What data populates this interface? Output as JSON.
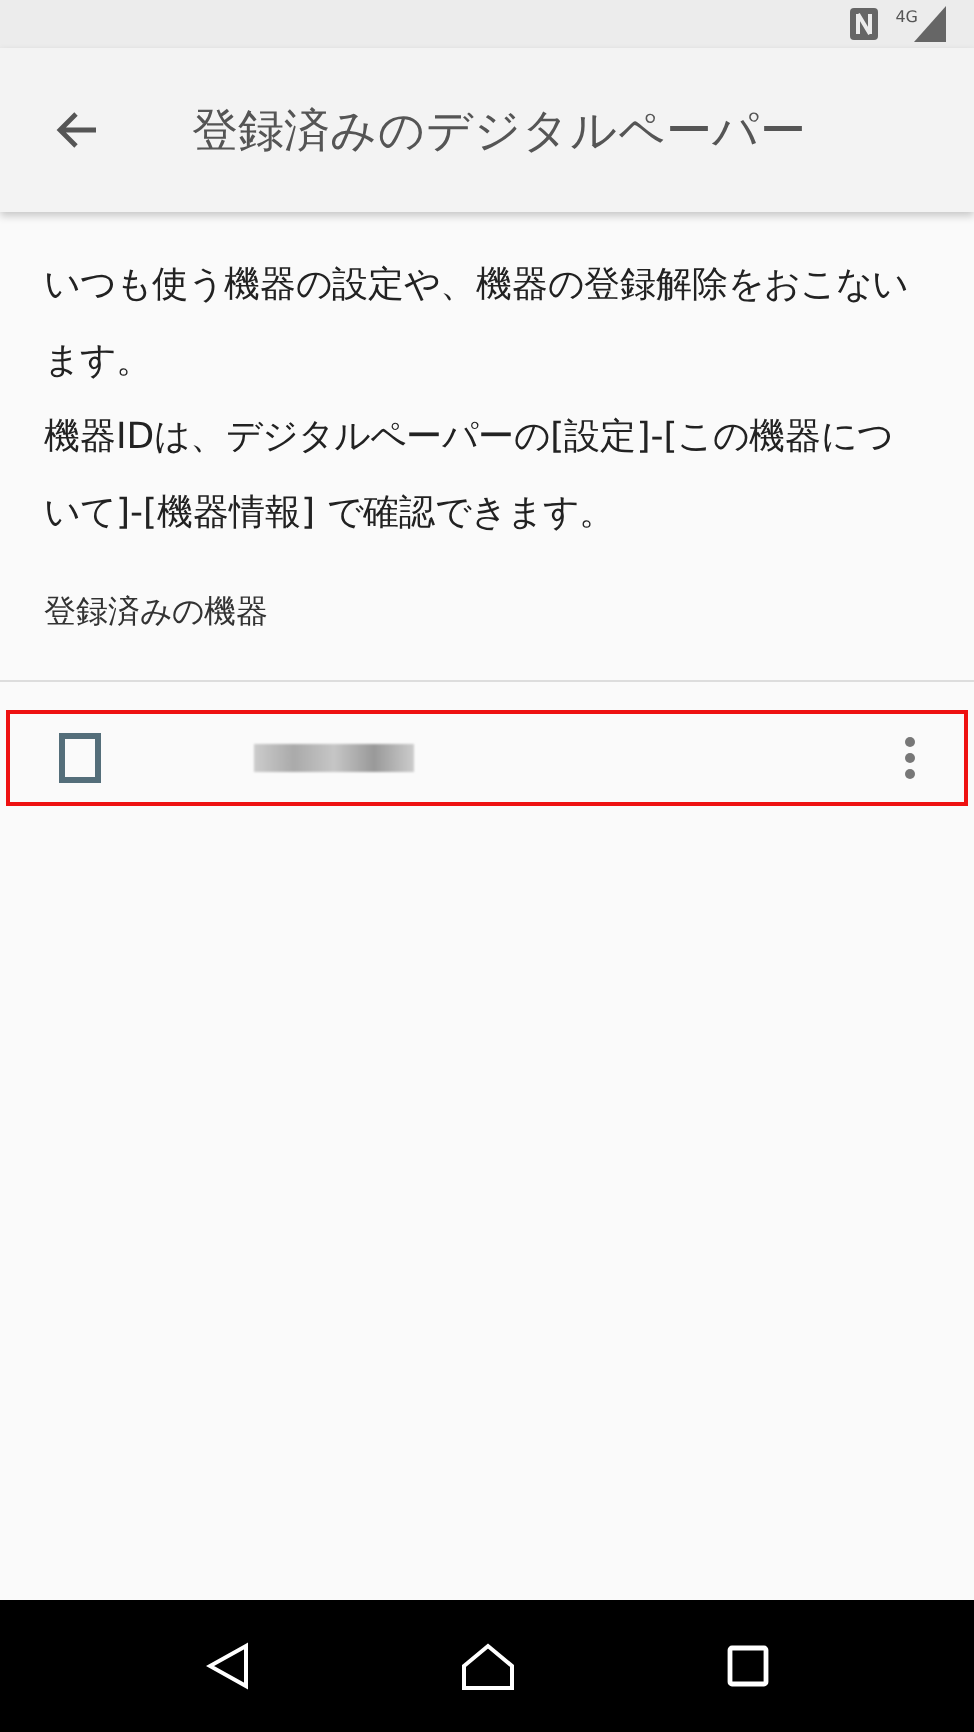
{
  "status_bar": {
    "network": "4G"
  },
  "app_bar": {
    "title": "登録済みのデジタルペーパー"
  },
  "description": [
    "いつも使う機器の設定や、機器の登録解除をおこないます。",
    "機器IDは、デジタルペーパーの[設定]-[この機器について]-[機器情報] で確認できます。"
  ],
  "section": {
    "title": "登録済みの機器"
  },
  "devices": [
    {
      "name_redacted": true,
      "highlighted": true
    }
  ]
}
